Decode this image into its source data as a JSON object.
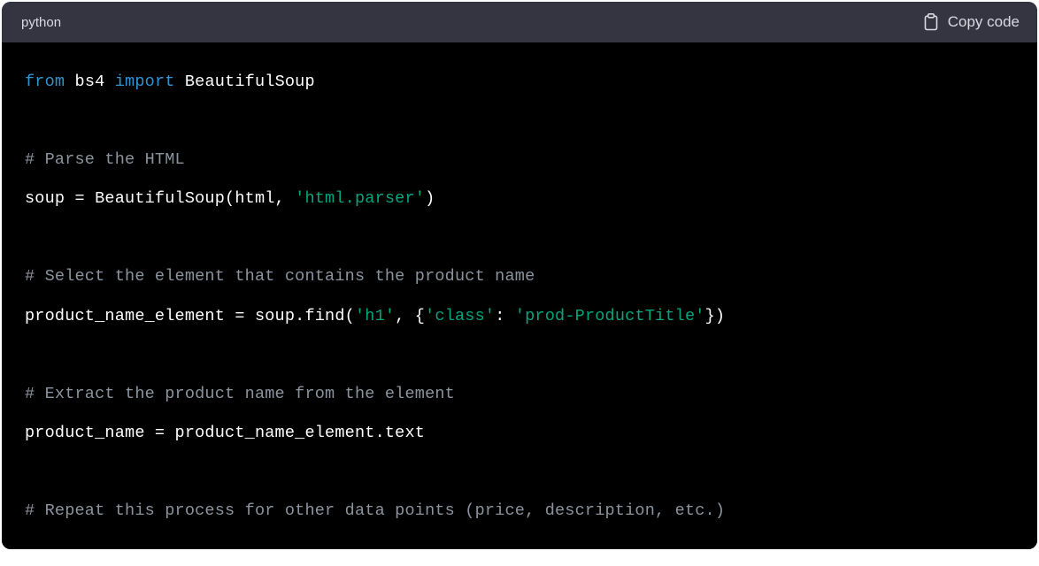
{
  "header": {
    "language_label": "python",
    "copy_label": "Copy code"
  },
  "code": {
    "lines": [
      [
        {
          "cls": "tok-keyword",
          "text": "from"
        },
        {
          "cls": "tok-default",
          "text": " bs4 "
        },
        {
          "cls": "tok-keyword",
          "text": "import"
        },
        {
          "cls": "tok-default",
          "text": " BeautifulSoup"
        }
      ],
      [
        {
          "cls": "tok-default",
          "text": ""
        }
      ],
      [
        {
          "cls": "tok-comment",
          "text": "# Parse the HTML"
        }
      ],
      [
        {
          "cls": "tok-default",
          "text": "soup = BeautifulSoup(html, "
        },
        {
          "cls": "tok-string",
          "text": "'html.parser'"
        },
        {
          "cls": "tok-default",
          "text": ")"
        }
      ],
      [
        {
          "cls": "tok-default",
          "text": ""
        }
      ],
      [
        {
          "cls": "tok-comment",
          "text": "# Select the element that contains the product name"
        }
      ],
      [
        {
          "cls": "tok-default",
          "text": "product_name_element = soup.find("
        },
        {
          "cls": "tok-string",
          "text": "'h1'"
        },
        {
          "cls": "tok-default",
          "text": ", {"
        },
        {
          "cls": "tok-string",
          "text": "'class'"
        },
        {
          "cls": "tok-default",
          "text": ": "
        },
        {
          "cls": "tok-string",
          "text": "'prod-ProductTitle'"
        },
        {
          "cls": "tok-default",
          "text": "})"
        }
      ],
      [
        {
          "cls": "tok-default",
          "text": ""
        }
      ],
      [
        {
          "cls": "tok-comment",
          "text": "# Extract the product name from the element"
        }
      ],
      [
        {
          "cls": "tok-default",
          "text": "product_name = product_name_element.text"
        }
      ],
      [
        {
          "cls": "tok-default",
          "text": ""
        }
      ],
      [
        {
          "cls": "tok-comment",
          "text": "# Repeat this process for other data points (price, description, etc.)"
        }
      ]
    ]
  }
}
